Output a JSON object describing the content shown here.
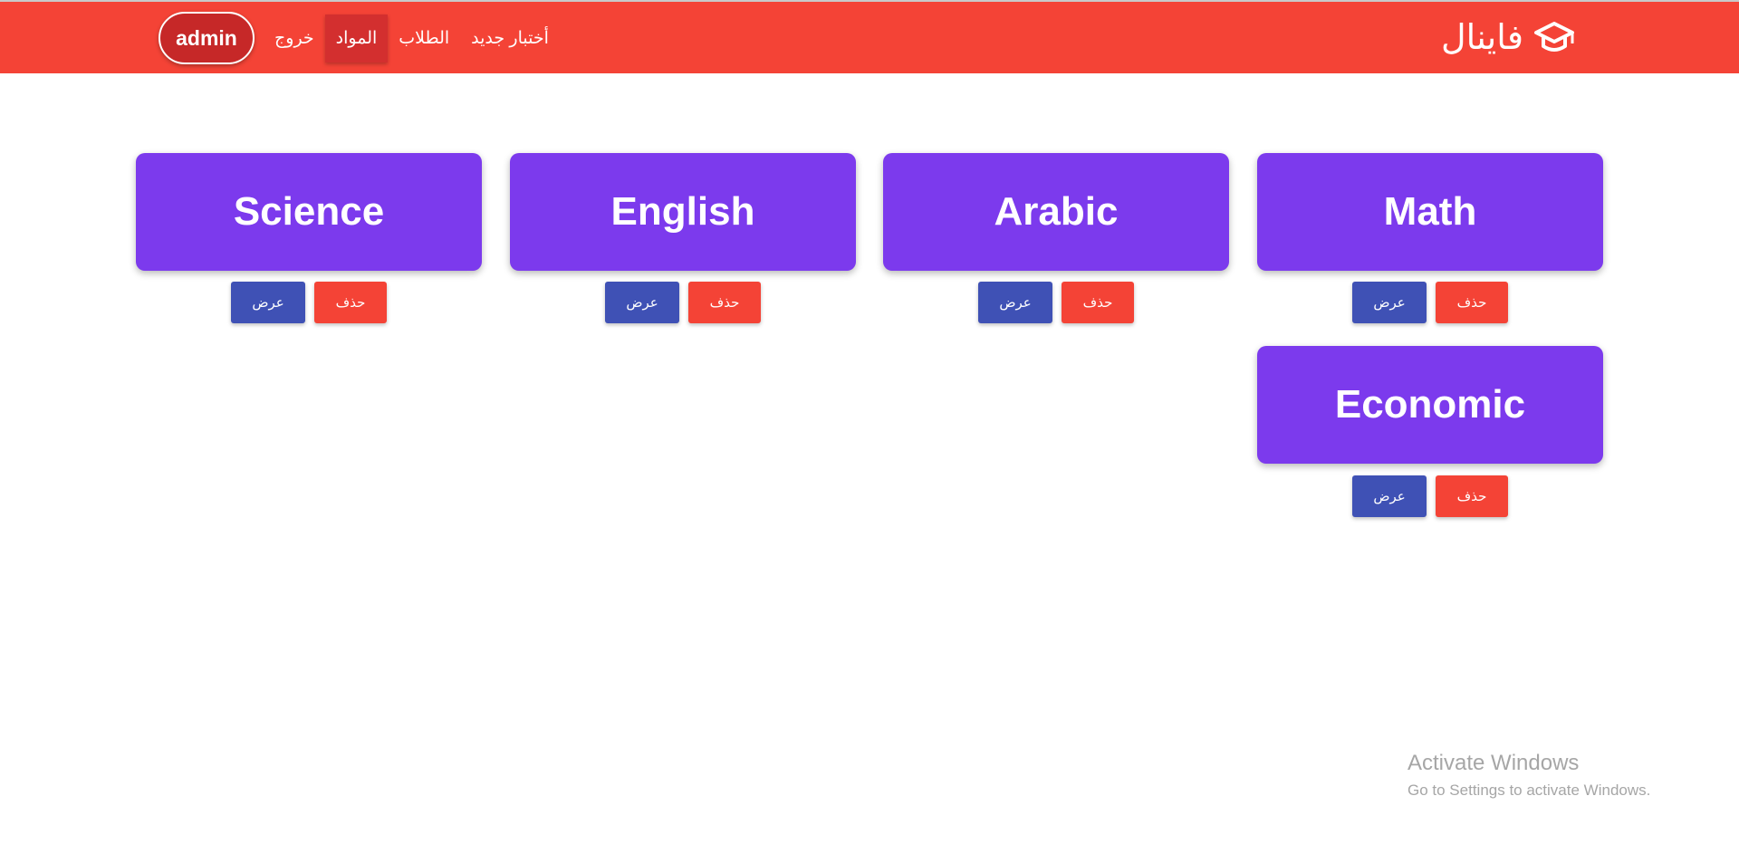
{
  "navbar": {
    "brand": "فاينال",
    "brand_icon": "graduation-cap-icon",
    "user": "admin",
    "links": [
      {
        "label": "خروج"
      },
      {
        "label": "المواد",
        "active": true
      },
      {
        "label": "الطلاب"
      },
      {
        "label": "أختبار جديد"
      }
    ],
    "color": "#f44336"
  },
  "subjects": [
    {
      "name": "Science",
      "view_label": "عرض",
      "delete_label": "حذف"
    },
    {
      "name": "English",
      "view_label": "عرض",
      "delete_label": "حذف"
    },
    {
      "name": "Arabic",
      "view_label": "عرض",
      "delete_label": "حذف"
    },
    {
      "name": "Math",
      "view_label": "عرض",
      "delete_label": "حذف"
    },
    {
      "name": "Economic",
      "view_label": "عرض",
      "delete_label": "حذف"
    }
  ],
  "card_color": "#7c3aed",
  "view_button_color": "#3f51b5",
  "delete_button_color": "#f44336",
  "watermark": {
    "title": "Activate Windows",
    "subtitle": "Go to Settings to activate Windows."
  }
}
